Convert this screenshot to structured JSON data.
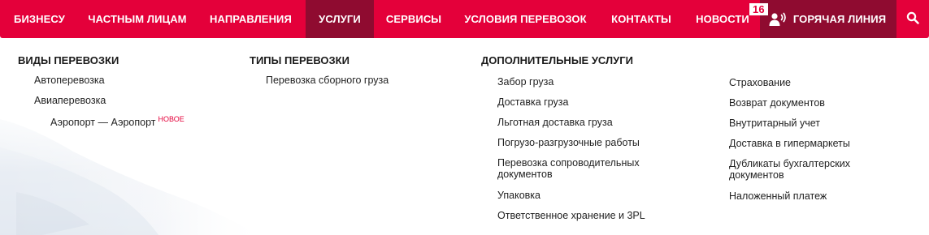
{
  "nav": {
    "items": [
      {
        "label": "БИЗНЕСУ",
        "active": false
      },
      {
        "label": "ЧАСТНЫМ ЛИЦАМ",
        "active": false
      },
      {
        "label": "НАПРАВЛЕНИЯ",
        "active": false
      },
      {
        "label": "УСЛУГИ",
        "active": true
      },
      {
        "label": "СЕРВИСЫ",
        "active": false
      },
      {
        "label": "УСЛОВИЯ ПЕРЕВОЗОК",
        "active": false
      },
      {
        "label": "КОНТАКТЫ",
        "active": false
      },
      {
        "label": "НОВОСТИ",
        "active": false
      }
    ],
    "badge_count": "16",
    "hotline_label": "ГОРЯЧАЯ ЛИНИЯ",
    "icons": {
      "hotline": "headset-person-icon",
      "search": "search-icon"
    }
  },
  "colors": {
    "brand": "#e4003a",
    "active": "#8f0b30",
    "text": "#222222"
  },
  "menu": {
    "transport_kinds": {
      "heading": "ВИДЫ ПЕРЕВОЗКИ",
      "items": [
        "Автоперевозка",
        "Авиаперевозка"
      ],
      "subitem": {
        "label": "Аэропорт — Аэропорт",
        "tag": "НОВОЕ"
      }
    },
    "transport_types": {
      "heading": "ТИПЫ ПЕРЕВОЗКИ",
      "items": [
        "Перевозка сборного груза"
      ]
    },
    "extra_services": {
      "heading": "ДОПОЛНИТЕЛЬНЫЕ УСЛУГИ",
      "left": [
        "Забор груза",
        "Доставка груза",
        "Льготная доставка груза",
        "Погрузо-разгрузочные работы",
        "Перевозка сопроводительных документов",
        "Упаковка",
        "Ответственное хранение и 3PL"
      ],
      "right": [
        "Страхование",
        "Возврат документов",
        "Внутритарный учет",
        "Доставка в гипермаркеты",
        "Дубликаты бухгалтерских документов",
        "Наложенный платеж"
      ]
    }
  }
}
